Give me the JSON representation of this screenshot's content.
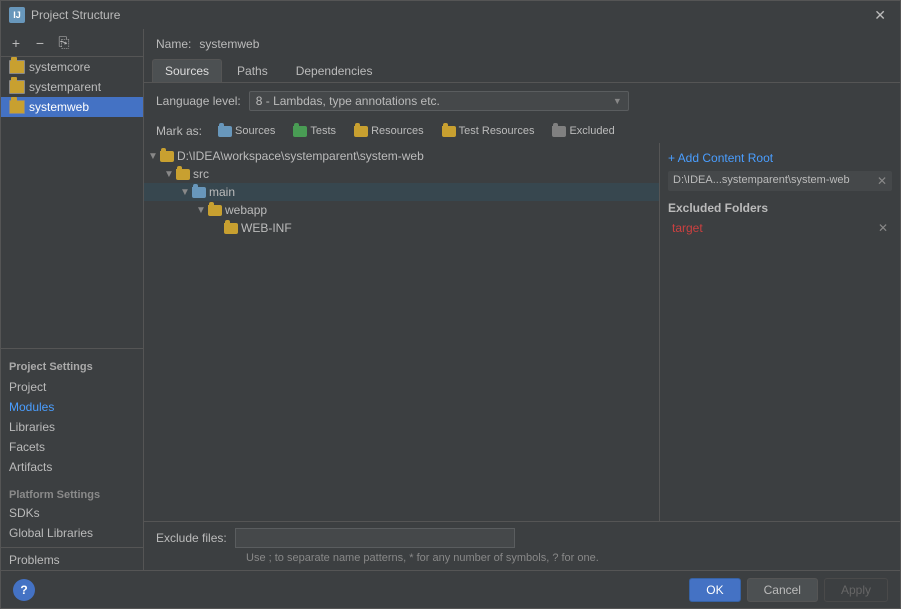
{
  "window": {
    "title": "Project Structure",
    "icon_label": "IJ"
  },
  "left_panel": {
    "toolbar": {
      "add_label": "+",
      "remove_label": "−",
      "copy_label": "⎘"
    },
    "modules": [
      {
        "name": "systemcore"
      },
      {
        "name": "systemparent"
      },
      {
        "name": "systemweb",
        "selected": true
      }
    ],
    "project_settings_header": "Project Settings",
    "nav_items": [
      {
        "id": "project",
        "label": "Project"
      },
      {
        "id": "modules",
        "label": "Modules",
        "active": true
      },
      {
        "id": "libraries",
        "label": "Libraries"
      },
      {
        "id": "facets",
        "label": "Facets"
      },
      {
        "id": "artifacts",
        "label": "Artifacts"
      }
    ],
    "platform_settings_header": "Platform Settings",
    "platform_items": [
      {
        "id": "sdks",
        "label": "SDKs"
      },
      {
        "id": "global-libraries",
        "label": "Global Libraries"
      }
    ],
    "problems_label": "Problems"
  },
  "right_panel": {
    "name_label": "Name:",
    "name_value": "systemweb",
    "tabs": [
      {
        "id": "sources",
        "label": "Sources",
        "active": true
      },
      {
        "id": "paths",
        "label": "Paths"
      },
      {
        "id": "dependencies",
        "label": "Dependencies"
      }
    ],
    "lang_label": "Language level:",
    "lang_value": "8 - Lambdas, type annotations etc.",
    "mark_label": "Mark as:",
    "mark_buttons": [
      {
        "id": "sources",
        "label": "Sources",
        "color": "blue"
      },
      {
        "id": "tests",
        "label": "Tests",
        "color": "green"
      },
      {
        "id": "resources",
        "label": "Resources",
        "color": "orange"
      },
      {
        "id": "test-resources",
        "label": "Test Resources",
        "color": "orange"
      },
      {
        "id": "excluded",
        "label": "Excluded",
        "color": "excluded"
      }
    ],
    "file_tree": {
      "root": {
        "path": "D:\\IDEA\\workspace\\systemparent\\system-web",
        "expanded": true,
        "children": [
          {
            "name": "src",
            "expanded": true,
            "children": [
              {
                "name": "main",
                "expanded": true,
                "selected": true,
                "children": [
                  {
                    "name": "webapp",
                    "expanded": true,
                    "children": [
                      {
                        "name": "WEB-INF"
                      }
                    ]
                  }
                ]
              }
            ]
          }
        ]
      }
    },
    "info_panel": {
      "add_content_root_label": "+ Add Content Root",
      "content_root_path": "D:\\IDEA...systemparent\\system-web",
      "excluded_header": "Excluded Folders",
      "excluded_items": [
        {
          "name": "target"
        }
      ]
    },
    "exclude_files_label": "Exclude files:",
    "exclude_files_value": "",
    "exclude_hint": "Use ; to separate name patterns, * for any number of symbols, ? for one."
  },
  "footer": {
    "ok_label": "OK",
    "cancel_label": "Cancel",
    "apply_label": "Apply",
    "help_label": "?"
  }
}
